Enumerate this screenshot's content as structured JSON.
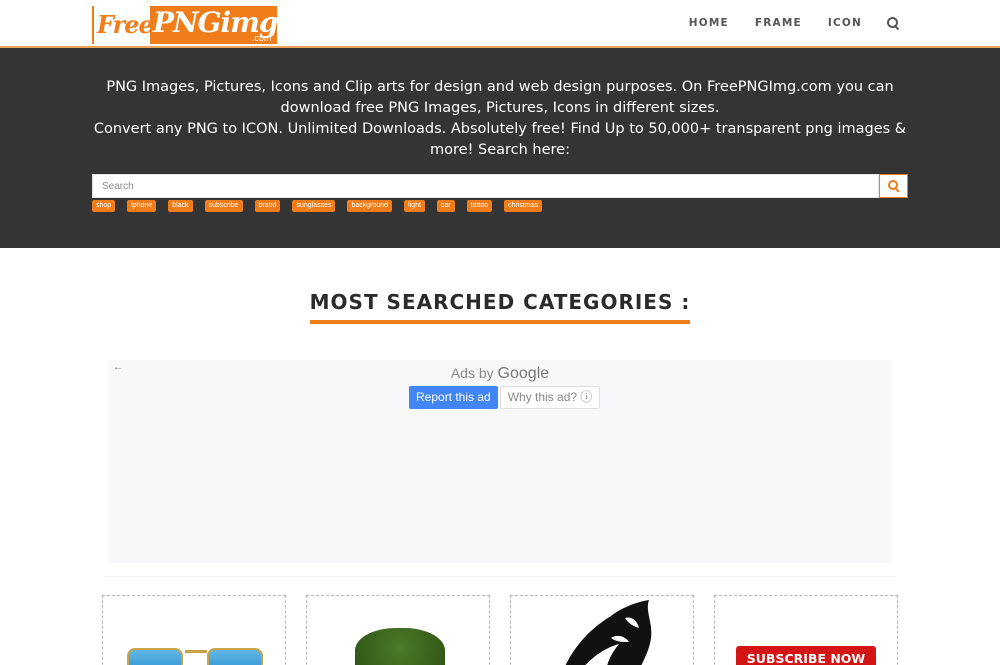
{
  "logo": {
    "free": "Free",
    "png": "PNGimg",
    "com": ".com"
  },
  "nav": {
    "items": [
      "HOME",
      "FRAME",
      "ICON"
    ]
  },
  "hero": {
    "line1": "PNG Images, Pictures, Icons and Clip arts for design and web design purposes. On FreePNGImg.com you can download free PNG Images, Pictures, Icons in different sizes.",
    "line2": "Convert any PNG to ICON. Unlimited Downloads. Absolutely free! Find Up to 50,000+ transparent png images & more! Search here:"
  },
  "search": {
    "placeholder": "Search"
  },
  "tags": [
    "shop",
    "iphone",
    "black",
    "subscribe",
    "brand",
    "sunglasses",
    "background",
    "light",
    "car",
    "tattoo",
    "christmas"
  ],
  "section": {
    "title": "MOST SEARCHED CATEGORIES :"
  },
  "ad": {
    "ads_by": "Ads by",
    "google": "Google",
    "report": "Report this ad",
    "why": "Why this ad? ⓘ",
    "back": "←"
  },
  "thumbnails": [
    {
      "subject": "sunglasses"
    },
    {
      "subject": "bonsai tree"
    },
    {
      "subject": "wolf tattoo"
    },
    {
      "subject": "subscribe button",
      "label": "SUBSCRIBE NOW"
    }
  ],
  "colors": {
    "accent": "#f07d1a",
    "hero_bg": "#343434",
    "ad_button": "#4285f4",
    "subscribe_red": "#d31515"
  }
}
